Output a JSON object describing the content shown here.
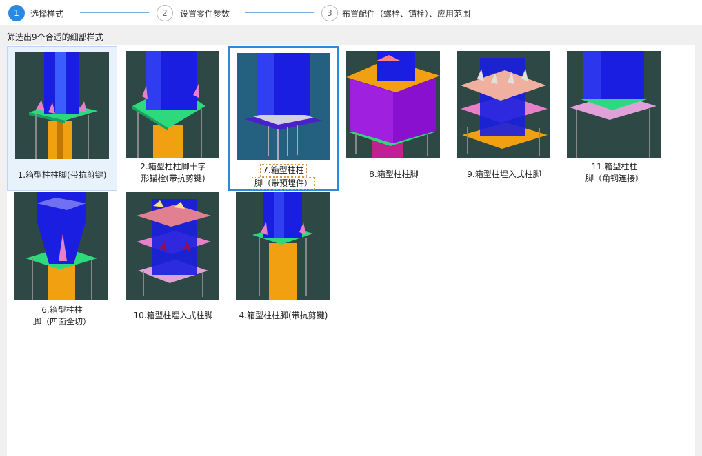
{
  "steps": [
    {
      "num": "1",
      "label": "选择样式",
      "active": true
    },
    {
      "num": "2",
      "label": "设置零件参数",
      "active": false
    },
    {
      "num": "3",
      "label": "布置配件（螺栓、锚栓）、应用范围",
      "active": false
    }
  ],
  "filter_text": "筛选出9个合适的细部样式",
  "cards": [
    {
      "label_lines": [
        "1.箱型柱柱脚(带抗剪键)"
      ],
      "state": "hover",
      "icon": "box-column-base-shear-key"
    },
    {
      "label_lines": [
        "2.箱型柱柱脚十字",
        "形锚栓(带抗剪键)"
      ],
      "state": "normal",
      "icon": "box-column-base-cross-anchor"
    },
    {
      "label_lines": [
        "7.箱型柱柱",
        "脚（带预埋件）"
      ],
      "state": "selected",
      "icon": "box-column-base-embedded"
    },
    {
      "label_lines": [
        "8.箱型柱柱脚"
      ],
      "state": "normal",
      "icon": "box-column-base"
    },
    {
      "label_lines": [
        "9.箱型柱埋入式柱脚"
      ],
      "state": "normal",
      "icon": "box-column-embedded-base"
    },
    {
      "label_lines": [
        "11.箱型柱柱",
        "脚（角钢连接）"
      ],
      "state": "normal",
      "icon": "box-column-base-angle"
    },
    {
      "label_lines": [
        "6.箱型柱柱",
        "脚（四面全切）"
      ],
      "state": "normal",
      "icon": "box-column-base-full-cut"
    },
    {
      "label_lines": [
        "10.箱型柱埋入式柱脚"
      ],
      "state": "normal",
      "icon": "box-column-embedded-base-2"
    },
    {
      "label_lines": [
        "4.箱型柱柱脚(带抗剪键)"
      ],
      "state": "normal",
      "icon": "box-column-base-shear-key-2"
    }
  ],
  "colors": {
    "accent": "#2b8ae0",
    "thumb_bg": "#2d4845",
    "column_blue": "#1a1ee0",
    "base_green": "#2ed87c",
    "orange": "#f0a010",
    "pink": "#e880c8",
    "purple": "#8a10d0"
  }
}
